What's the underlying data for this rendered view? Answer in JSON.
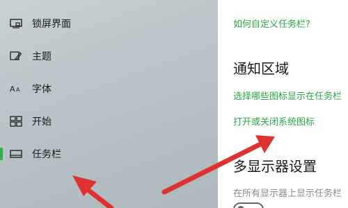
{
  "sidebar": {
    "items": [
      {
        "label": "锁屏界面",
        "icon": "lock-screen-icon"
      },
      {
        "label": "主题",
        "icon": "theme-icon"
      },
      {
        "label": "字体",
        "icon": "font-icon"
      },
      {
        "label": "开始",
        "icon": "start-icon"
      },
      {
        "label": "任务栏",
        "icon": "taskbar-icon",
        "active": true
      }
    ]
  },
  "content": {
    "custom_taskbar_link": "如何自定义任务栏?",
    "notification_heading": "通知区域",
    "select_icons_link": "选择哪些图标显示在任务栏",
    "system_icons_link": "打开或关闭系统图标",
    "multi_display_heading": "多显示器设置",
    "show_on_all_displays_desc": "在所有显示器上显示任务栏"
  },
  "colors": {
    "accent": "#27a844",
    "annotation_arrow": "#e03131"
  }
}
